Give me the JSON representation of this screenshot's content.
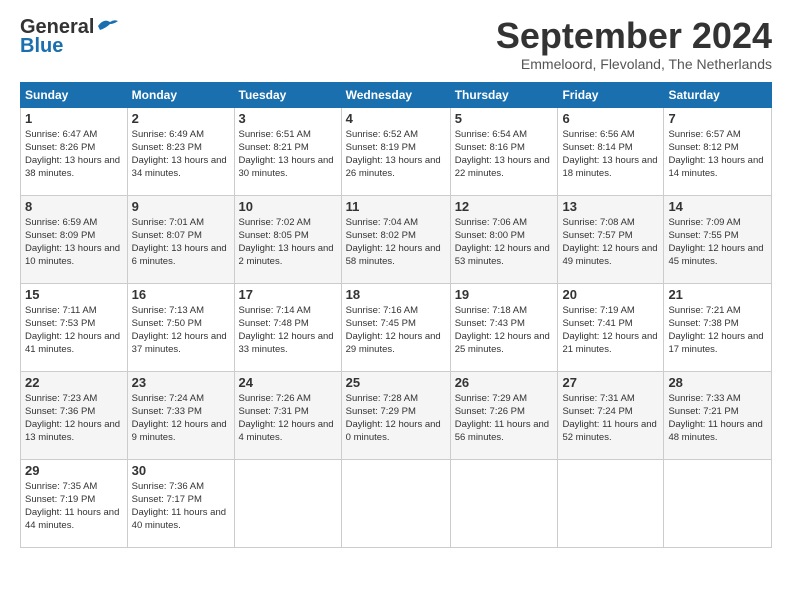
{
  "logo": {
    "line1": "General",
    "line2": "Blue"
  },
  "header": {
    "title": "September 2024",
    "subtitle": "Emmeloord, Flevoland, The Netherlands"
  },
  "weekdays": [
    "Sunday",
    "Monday",
    "Tuesday",
    "Wednesday",
    "Thursday",
    "Friday",
    "Saturday"
  ],
  "weeks": [
    [
      {
        "day": "1",
        "sunrise": "6:47 AM",
        "sunset": "8:26 PM",
        "daylight": "13 hours and 38 minutes."
      },
      {
        "day": "2",
        "sunrise": "6:49 AM",
        "sunset": "8:23 PM",
        "daylight": "13 hours and 34 minutes."
      },
      {
        "day": "3",
        "sunrise": "6:51 AM",
        "sunset": "8:21 PM",
        "daylight": "13 hours and 30 minutes."
      },
      {
        "day": "4",
        "sunrise": "6:52 AM",
        "sunset": "8:19 PM",
        "daylight": "13 hours and 26 minutes."
      },
      {
        "day": "5",
        "sunrise": "6:54 AM",
        "sunset": "8:16 PM",
        "daylight": "13 hours and 22 minutes."
      },
      {
        "day": "6",
        "sunrise": "6:56 AM",
        "sunset": "8:14 PM",
        "daylight": "13 hours and 18 minutes."
      },
      {
        "day": "7",
        "sunrise": "6:57 AM",
        "sunset": "8:12 PM",
        "daylight": "13 hours and 14 minutes."
      }
    ],
    [
      {
        "day": "8",
        "sunrise": "6:59 AM",
        "sunset": "8:09 PM",
        "daylight": "13 hours and 10 minutes."
      },
      {
        "day": "9",
        "sunrise": "7:01 AM",
        "sunset": "8:07 PM",
        "daylight": "13 hours and 6 minutes."
      },
      {
        "day": "10",
        "sunrise": "7:02 AM",
        "sunset": "8:05 PM",
        "daylight": "13 hours and 2 minutes."
      },
      {
        "day": "11",
        "sunrise": "7:04 AM",
        "sunset": "8:02 PM",
        "daylight": "12 hours and 58 minutes."
      },
      {
        "day": "12",
        "sunrise": "7:06 AM",
        "sunset": "8:00 PM",
        "daylight": "12 hours and 53 minutes."
      },
      {
        "day": "13",
        "sunrise": "7:08 AM",
        "sunset": "7:57 PM",
        "daylight": "12 hours and 49 minutes."
      },
      {
        "day": "14",
        "sunrise": "7:09 AM",
        "sunset": "7:55 PM",
        "daylight": "12 hours and 45 minutes."
      }
    ],
    [
      {
        "day": "15",
        "sunrise": "7:11 AM",
        "sunset": "7:53 PM",
        "daylight": "12 hours and 41 minutes."
      },
      {
        "day": "16",
        "sunrise": "7:13 AM",
        "sunset": "7:50 PM",
        "daylight": "12 hours and 37 minutes."
      },
      {
        "day": "17",
        "sunrise": "7:14 AM",
        "sunset": "7:48 PM",
        "daylight": "12 hours and 33 minutes."
      },
      {
        "day": "18",
        "sunrise": "7:16 AM",
        "sunset": "7:45 PM",
        "daylight": "12 hours and 29 minutes."
      },
      {
        "day": "19",
        "sunrise": "7:18 AM",
        "sunset": "7:43 PM",
        "daylight": "12 hours and 25 minutes."
      },
      {
        "day": "20",
        "sunrise": "7:19 AM",
        "sunset": "7:41 PM",
        "daylight": "12 hours and 21 minutes."
      },
      {
        "day": "21",
        "sunrise": "7:21 AM",
        "sunset": "7:38 PM",
        "daylight": "12 hours and 17 minutes."
      }
    ],
    [
      {
        "day": "22",
        "sunrise": "7:23 AM",
        "sunset": "7:36 PM",
        "daylight": "12 hours and 13 minutes."
      },
      {
        "day": "23",
        "sunrise": "7:24 AM",
        "sunset": "7:33 PM",
        "daylight": "12 hours and 9 minutes."
      },
      {
        "day": "24",
        "sunrise": "7:26 AM",
        "sunset": "7:31 PM",
        "daylight": "12 hours and 4 minutes."
      },
      {
        "day": "25",
        "sunrise": "7:28 AM",
        "sunset": "7:29 PM",
        "daylight": "12 hours and 0 minutes."
      },
      {
        "day": "26",
        "sunrise": "7:29 AM",
        "sunset": "7:26 PM",
        "daylight": "11 hours and 56 minutes."
      },
      {
        "day": "27",
        "sunrise": "7:31 AM",
        "sunset": "7:24 PM",
        "daylight": "11 hours and 52 minutes."
      },
      {
        "day": "28",
        "sunrise": "7:33 AM",
        "sunset": "7:21 PM",
        "daylight": "11 hours and 48 minutes."
      }
    ],
    [
      {
        "day": "29",
        "sunrise": "7:35 AM",
        "sunset": "7:19 PM",
        "daylight": "11 hours and 44 minutes."
      },
      {
        "day": "30",
        "sunrise": "7:36 AM",
        "sunset": "7:17 PM",
        "daylight": "11 hours and 40 minutes."
      },
      null,
      null,
      null,
      null,
      null
    ]
  ]
}
